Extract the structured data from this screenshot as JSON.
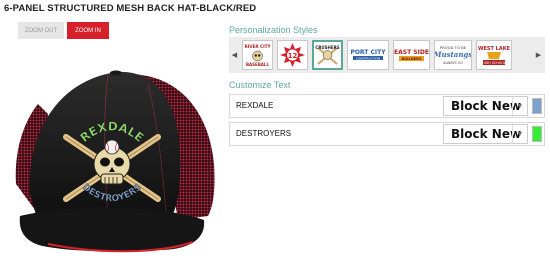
{
  "product": {
    "title": "6-PANEL STRUCTURED MESH BACK HAT-BLACK/RED"
  },
  "zoom": {
    "out_label": "ZOOM OUT",
    "in_label": "ZOOM IN"
  },
  "hat": {
    "top_text": "REXDALE",
    "bottom_text": "DESTROYERS",
    "top_color": "#8dd66a",
    "bottom_color": "#7fa0c9"
  },
  "personalization": {
    "title": "Personalization Styles",
    "prev_icon": "chevron-left-icon",
    "next_icon": "chevron-right-icon",
    "styles": [
      {
        "lines": [
          "RIVER CITY",
          "BASEBALL"
        ]
      },
      {
        "lines": [
          "12"
        ]
      },
      {
        "lines": [
          "CRUSHERS"
        ]
      },
      {
        "lines": [
          "PORT CITY",
          "CONSTRUCTION"
        ]
      },
      {
        "lines": [
          "EAST SIDE",
          "BUILDERS"
        ]
      },
      {
        "lines": [
          "PROUD TO BE",
          "Mustangs",
          "ALWAYS GO"
        ]
      },
      {
        "lines": [
          "WEST LAKE",
          "HIGH SCHOOL"
        ]
      }
    ]
  },
  "customize": {
    "title": "Customize Text",
    "rows": [
      {
        "text": "REXDALE",
        "font": "Block New",
        "color": "#7fa0c9"
      },
      {
        "text": "DESTROYERS",
        "font": "Block New",
        "color": "#33ee33"
      }
    ]
  }
}
